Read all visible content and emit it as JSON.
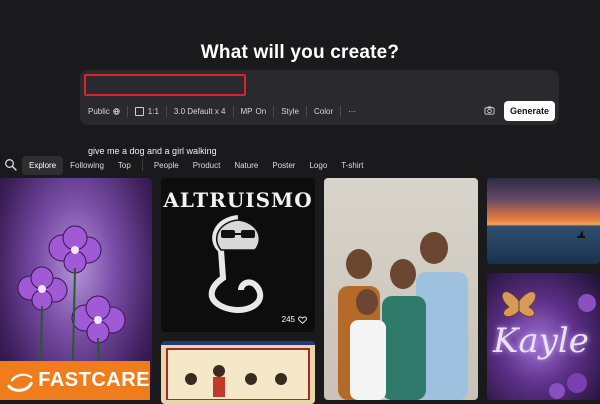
{
  "header": {
    "title": "What will you create?"
  },
  "prompt": {
    "value": "give me a dog and a girl walking"
  },
  "options": {
    "visibility": "Public",
    "aspect_ratio": "1:1",
    "model": "3.0 Default x 4",
    "mp": "MP",
    "mp_state": "On",
    "style": "Style",
    "color": "Color",
    "more": "···"
  },
  "generate_label": "Generate",
  "tabs": [
    "Explore",
    "Following",
    "Top",
    "People",
    "Product",
    "Nature",
    "Poster",
    "Logo",
    "T-shirt"
  ],
  "gallery": {
    "cobra_title": "ALTRUISMO",
    "cobra_likes": "245",
    "kayle_text": "Kayle"
  },
  "watermark": {
    "brand": "FASTCARE"
  },
  "colors": {
    "background": "#1a1a1c",
    "panel": "#2a2a2e",
    "highlight": "#d8232a",
    "button": "#ffffff",
    "watermark": "#f07d1c"
  }
}
